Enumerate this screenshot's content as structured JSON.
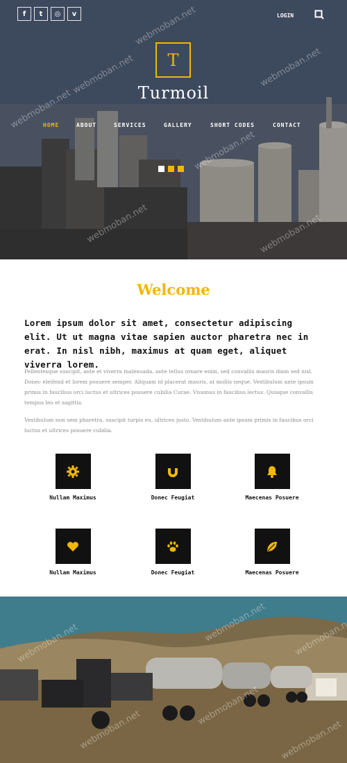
{
  "header": {
    "social": [
      {
        "icon": "facebook-icon",
        "glyph": "f"
      },
      {
        "icon": "twitter-icon",
        "glyph": "t"
      },
      {
        "icon": "dribbble-icon",
        "glyph": "◎"
      },
      {
        "icon": "vimeo-icon",
        "glyph": "v"
      }
    ],
    "login_label": "LOGIN",
    "logo_letter": "T",
    "brand_name": "Turmoil",
    "nav": [
      "HOME",
      "ABOUT",
      "SERVICES",
      "GALLERY",
      "SHORT CODES",
      "CONTACT"
    ],
    "active_nav": "HOME",
    "slider_dots": 3,
    "active_dot": 0
  },
  "welcome": {
    "title": "Welcome",
    "lead": "Lorem ipsum dolor sit amet, consectetur adipiscing elit. Ut ut magna vitae sapien auctor pharetra nec in erat. In nisl nibh, maximus at quam eget, aliquet viverra lorem.",
    "para1": "Pellentesque suscipit, ante et viverra malesuada, ante tellus ornare enim, sed convallis mauris diam sed nisl. Donec eleifend et lorem posuere semper. Aliquam id placerat mauris, at mollis neque. Vestibulum ante ipsum primis in faucibus orci luctus et ultrices posuere cubilia Curae. Vivamus in faucibus lectus. Quisque convallis tempus leo et sagittis.",
    "para2": "Vestibulum non sem pharetra, suscipit turpis eu, ultrices justo. Vestibulum ante ipsum primis in faucibus orci luctus et ultrices posuere cubilia."
  },
  "features": [
    {
      "icon": "gear-icon",
      "label": "Nullam Maximus"
    },
    {
      "icon": "magnet-icon",
      "label": "Donec Feugiat"
    },
    {
      "icon": "bell-icon",
      "label": "Maecenas Posuere"
    },
    {
      "icon": "heart-icon",
      "label": "Nullam Maximus"
    },
    {
      "icon": "paw-icon",
      "label": "Donec Feugiat"
    },
    {
      "icon": "leaf-icon",
      "label": "Maecenas Posuere"
    }
  ],
  "colors": {
    "accent": "#f2b705",
    "dark": "#111111",
    "text_muted": "#8a8a8a"
  },
  "watermark": "webmoban.net"
}
